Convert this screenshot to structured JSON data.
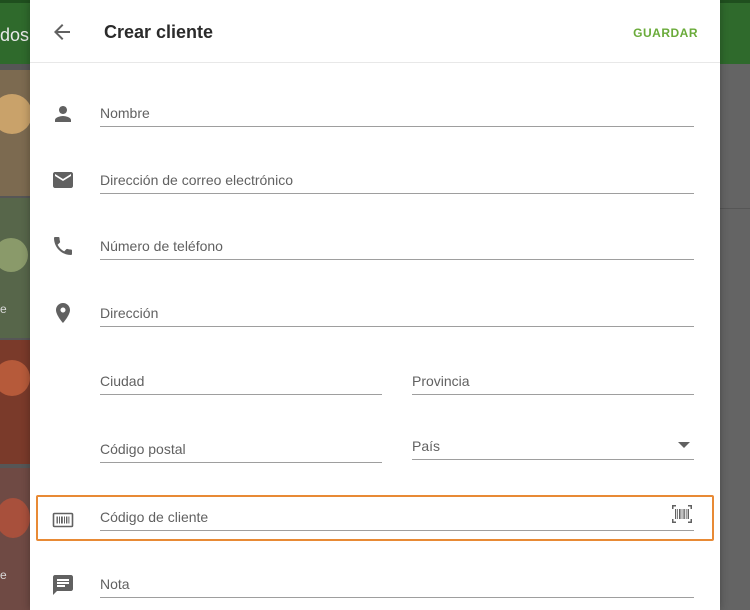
{
  "background": {
    "topbar_text": "dos",
    "tile_labels": [
      "e",
      "e"
    ]
  },
  "dialog": {
    "title": "Crear cliente",
    "save_label": "GUARDAR",
    "fields": {
      "name": "Nombre",
      "email": "Dirección de correo electrónico",
      "phone": "Número de teléfono",
      "address": "Dirección",
      "city": "Ciudad",
      "province": "Provincia",
      "postal_code": "Código postal",
      "country": "País",
      "customer_code": "Código de cliente",
      "note": "Nota"
    }
  },
  "colors": {
    "accent": "#6aab3a",
    "highlight": "#e88a35",
    "icon": "#616161"
  }
}
